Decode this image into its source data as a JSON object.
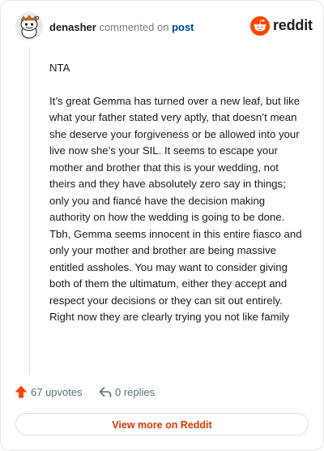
{
  "header": {
    "username": "denasher",
    "verb": "commented on",
    "link_text": "post",
    "brand": "reddit",
    "avatar_icon": "snoo-avatar-icon",
    "brand_icon": "reddit-logo-icon",
    "brand_color": "#ff4500"
  },
  "comment": {
    "paragraphs": [
      "NTA",
      "It’s great Gemma has turned over a new leaf, but like what your father stated very aptly, that doesn’t mean she deserve your forgiveness or be allowed into your live now she’s your SIL. It seems to escape your mother and brother that this is your wedding, not theirs and they have absolutely zero say in things; only you and fiancé have the decision making authority on how the wedding is going to be done. Tbh, Gemma seems innocent in this entire fiasco and only your mother and brother are being massive entitled assholes. You may want to consider giving both of them the ultimatum, either they accept and respect your decisions or they can sit out entirely. Right now they are clearly trying you not like family"
    ]
  },
  "actions": {
    "upvotes_label": "67 upvotes",
    "upvote_icon": "upvote-arrow-icon",
    "upvote_color": "#ff4500",
    "replies_label": "0 replies",
    "reply_icon": "reply-arrow-icon"
  },
  "footer": {
    "button_label": "View more on Reddit"
  }
}
